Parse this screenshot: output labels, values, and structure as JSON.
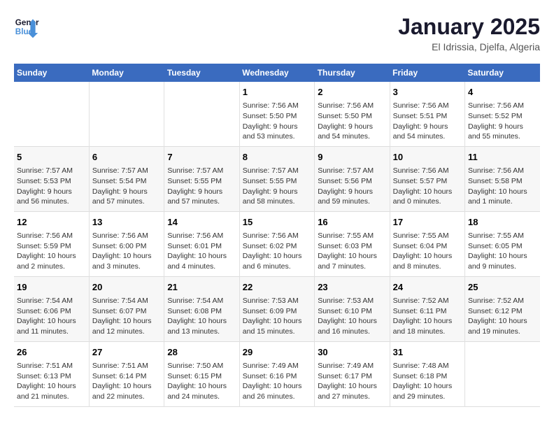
{
  "header": {
    "logo_line1": "General",
    "logo_line2": "Blue",
    "title": "January 2025",
    "subtitle": "El Idrissia, Djelfa, Algeria"
  },
  "weekdays": [
    "Sunday",
    "Monday",
    "Tuesday",
    "Wednesday",
    "Thursday",
    "Friday",
    "Saturday"
  ],
  "weeks": [
    [
      {
        "day": "",
        "info": ""
      },
      {
        "day": "",
        "info": ""
      },
      {
        "day": "",
        "info": ""
      },
      {
        "day": "1",
        "info": "Sunrise: 7:56 AM\nSunset: 5:50 PM\nDaylight: 9 hours and 53 minutes."
      },
      {
        "day": "2",
        "info": "Sunrise: 7:56 AM\nSunset: 5:50 PM\nDaylight: 9 hours and 54 minutes."
      },
      {
        "day": "3",
        "info": "Sunrise: 7:56 AM\nSunset: 5:51 PM\nDaylight: 9 hours and 54 minutes."
      },
      {
        "day": "4",
        "info": "Sunrise: 7:56 AM\nSunset: 5:52 PM\nDaylight: 9 hours and 55 minutes."
      }
    ],
    [
      {
        "day": "5",
        "info": "Sunrise: 7:57 AM\nSunset: 5:53 PM\nDaylight: 9 hours and 56 minutes."
      },
      {
        "day": "6",
        "info": "Sunrise: 7:57 AM\nSunset: 5:54 PM\nDaylight: 9 hours and 57 minutes."
      },
      {
        "day": "7",
        "info": "Sunrise: 7:57 AM\nSunset: 5:55 PM\nDaylight: 9 hours and 57 minutes."
      },
      {
        "day": "8",
        "info": "Sunrise: 7:57 AM\nSunset: 5:55 PM\nDaylight: 9 hours and 58 minutes."
      },
      {
        "day": "9",
        "info": "Sunrise: 7:57 AM\nSunset: 5:56 PM\nDaylight: 9 hours and 59 minutes."
      },
      {
        "day": "10",
        "info": "Sunrise: 7:56 AM\nSunset: 5:57 PM\nDaylight: 10 hours and 0 minutes."
      },
      {
        "day": "11",
        "info": "Sunrise: 7:56 AM\nSunset: 5:58 PM\nDaylight: 10 hours and 1 minute."
      }
    ],
    [
      {
        "day": "12",
        "info": "Sunrise: 7:56 AM\nSunset: 5:59 PM\nDaylight: 10 hours and 2 minutes."
      },
      {
        "day": "13",
        "info": "Sunrise: 7:56 AM\nSunset: 6:00 PM\nDaylight: 10 hours and 3 minutes."
      },
      {
        "day": "14",
        "info": "Sunrise: 7:56 AM\nSunset: 6:01 PM\nDaylight: 10 hours and 4 minutes."
      },
      {
        "day": "15",
        "info": "Sunrise: 7:56 AM\nSunset: 6:02 PM\nDaylight: 10 hours and 6 minutes."
      },
      {
        "day": "16",
        "info": "Sunrise: 7:55 AM\nSunset: 6:03 PM\nDaylight: 10 hours and 7 minutes."
      },
      {
        "day": "17",
        "info": "Sunrise: 7:55 AM\nSunset: 6:04 PM\nDaylight: 10 hours and 8 minutes."
      },
      {
        "day": "18",
        "info": "Sunrise: 7:55 AM\nSunset: 6:05 PM\nDaylight: 10 hours and 9 minutes."
      }
    ],
    [
      {
        "day": "19",
        "info": "Sunrise: 7:54 AM\nSunset: 6:06 PM\nDaylight: 10 hours and 11 minutes."
      },
      {
        "day": "20",
        "info": "Sunrise: 7:54 AM\nSunset: 6:07 PM\nDaylight: 10 hours and 12 minutes."
      },
      {
        "day": "21",
        "info": "Sunrise: 7:54 AM\nSunset: 6:08 PM\nDaylight: 10 hours and 13 minutes."
      },
      {
        "day": "22",
        "info": "Sunrise: 7:53 AM\nSunset: 6:09 PM\nDaylight: 10 hours and 15 minutes."
      },
      {
        "day": "23",
        "info": "Sunrise: 7:53 AM\nSunset: 6:10 PM\nDaylight: 10 hours and 16 minutes."
      },
      {
        "day": "24",
        "info": "Sunrise: 7:52 AM\nSunset: 6:11 PM\nDaylight: 10 hours and 18 minutes."
      },
      {
        "day": "25",
        "info": "Sunrise: 7:52 AM\nSunset: 6:12 PM\nDaylight: 10 hours and 19 minutes."
      }
    ],
    [
      {
        "day": "26",
        "info": "Sunrise: 7:51 AM\nSunset: 6:13 PM\nDaylight: 10 hours and 21 minutes."
      },
      {
        "day": "27",
        "info": "Sunrise: 7:51 AM\nSunset: 6:14 PM\nDaylight: 10 hours and 22 minutes."
      },
      {
        "day": "28",
        "info": "Sunrise: 7:50 AM\nSunset: 6:15 PM\nDaylight: 10 hours and 24 minutes."
      },
      {
        "day": "29",
        "info": "Sunrise: 7:49 AM\nSunset: 6:16 PM\nDaylight: 10 hours and 26 minutes."
      },
      {
        "day": "30",
        "info": "Sunrise: 7:49 AM\nSunset: 6:17 PM\nDaylight: 10 hours and 27 minutes."
      },
      {
        "day": "31",
        "info": "Sunrise: 7:48 AM\nSunset: 6:18 PM\nDaylight: 10 hours and 29 minutes."
      },
      {
        "day": "",
        "info": ""
      }
    ]
  ]
}
